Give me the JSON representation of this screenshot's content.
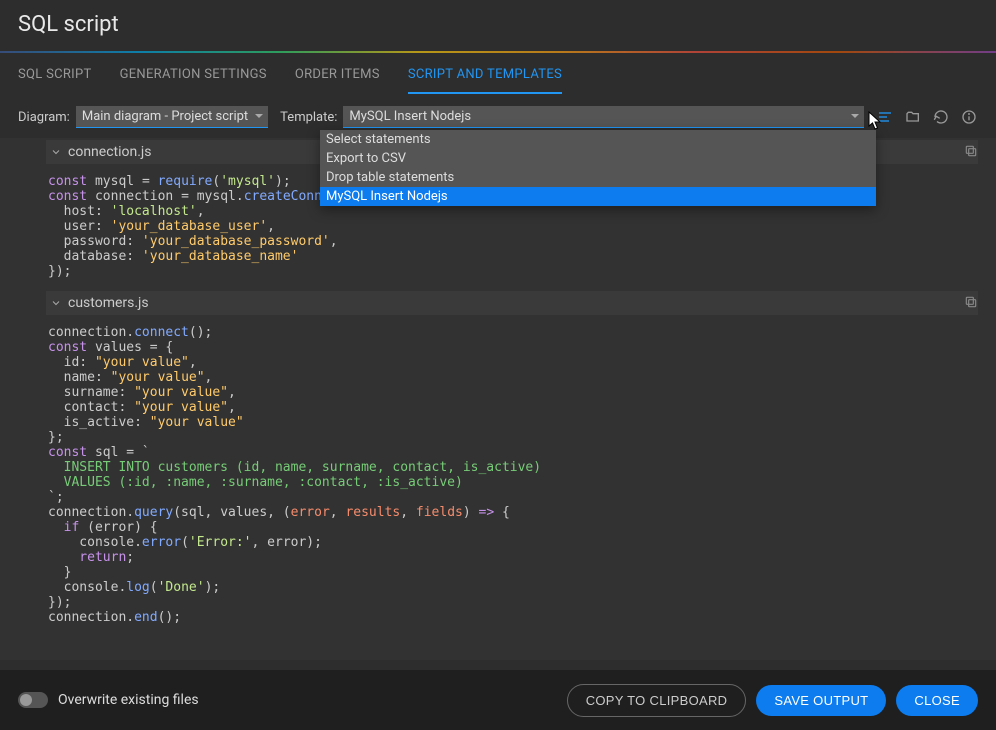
{
  "title": "SQL script",
  "tabs": [
    "SQL SCRIPT",
    "GENERATION SETTINGS",
    "ORDER ITEMS",
    "SCRIPT AND TEMPLATES"
  ],
  "diagram_label": "Diagram:",
  "diagram_value": "Main diagram - Project script",
  "template_label": "Template:",
  "template_value": "MySQL Insert Nodejs",
  "dropdown_options": [
    "Select statements",
    "Export to CSV",
    "Drop table statements",
    "MySQL Insert Nodejs"
  ],
  "files": {
    "file1": {
      "name": "connection.js",
      "code_tokens": [
        {
          "t": "const",
          "c": "kw"
        },
        {
          "t": " mysql ",
          "c": "id"
        },
        {
          "t": "=",
          "c": "id"
        },
        {
          "t": " ",
          "c": "id"
        },
        {
          "t": "require",
          "c": "fn"
        },
        {
          "t": "(",
          "c": "id"
        },
        {
          "t": "'mysql'",
          "c": "str"
        },
        {
          "t": ");\n",
          "c": "id"
        },
        {
          "t": "const",
          "c": "kw"
        },
        {
          "t": " connection ",
          "c": "id"
        },
        {
          "t": "=",
          "c": "id"
        },
        {
          "t": " mysql.",
          "c": "id"
        },
        {
          "t": "createConnection",
          "c": "fn"
        },
        {
          "t": "({\n",
          "c": "id"
        },
        {
          "t": "  host: ",
          "c": "id"
        },
        {
          "t": "'localhost'",
          "c": "str"
        },
        {
          "t": ",\n",
          "c": "id"
        },
        {
          "t": "  user: ",
          "c": "id"
        },
        {
          "t": "'your_database_user'",
          "c": "str2"
        },
        {
          "t": ",\n",
          "c": "id"
        },
        {
          "t": "  password: ",
          "c": "id"
        },
        {
          "t": "'your_database_password'",
          "c": "str2"
        },
        {
          "t": ",\n",
          "c": "id"
        },
        {
          "t": "  database: ",
          "c": "id"
        },
        {
          "t": "'your_database_name'",
          "c": "str2"
        },
        {
          "t": "\n",
          "c": "id"
        },
        {
          "t": "});",
          "c": "id"
        }
      ]
    },
    "file2": {
      "name": "customers.js",
      "code_tokens": [
        {
          "t": "connection.",
          "c": "id"
        },
        {
          "t": "connect",
          "c": "fn"
        },
        {
          "t": "();\n",
          "c": "id"
        },
        {
          "t": "const",
          "c": "kw"
        },
        {
          "t": " values ",
          "c": "id"
        },
        {
          "t": "=",
          "c": "id"
        },
        {
          "t": " {\n",
          "c": "id"
        },
        {
          "t": "  id: ",
          "c": "id"
        },
        {
          "t": "\"your value\"",
          "c": "str2"
        },
        {
          "t": ",\n",
          "c": "id"
        },
        {
          "t": "  name: ",
          "c": "id"
        },
        {
          "t": "\"your value\"",
          "c": "str2"
        },
        {
          "t": ",\n",
          "c": "id"
        },
        {
          "t": "  surname: ",
          "c": "id"
        },
        {
          "t": "\"your value\"",
          "c": "str2"
        },
        {
          "t": ",\n",
          "c": "id"
        },
        {
          "t": "  contact: ",
          "c": "id"
        },
        {
          "t": "\"your value\"",
          "c": "str2"
        },
        {
          "t": ",\n",
          "c": "id"
        },
        {
          "t": "  is_active: ",
          "c": "id"
        },
        {
          "t": "\"your value\"",
          "c": "str2"
        },
        {
          "t": "\n",
          "c": "id"
        },
        {
          "t": "};\n",
          "c": "id"
        },
        {
          "t": "const",
          "c": "kw"
        },
        {
          "t": " sql ",
          "c": "id"
        },
        {
          "t": "=",
          "c": "id"
        },
        {
          "t": " `\n",
          "c": "id"
        },
        {
          "t": "  INSERT INTO customers (id, name, surname, contact, is_active)\n",
          "c": "cm"
        },
        {
          "t": "  VALUES (:id, :name, :surname, :contact, :is_active)\n",
          "c": "cm"
        },
        {
          "t": "`;\n",
          "c": "id"
        },
        {
          "t": "connection.",
          "c": "id"
        },
        {
          "t": "query",
          "c": "fn"
        },
        {
          "t": "(sql, values, (",
          "c": "id"
        },
        {
          "t": "error",
          "c": "param"
        },
        {
          "t": ", ",
          "c": "id"
        },
        {
          "t": "results",
          "c": "param"
        },
        {
          "t": ", ",
          "c": "id"
        },
        {
          "t": "fields",
          "c": "param"
        },
        {
          "t": ") ",
          "c": "id"
        },
        {
          "t": "=>",
          "c": "kw"
        },
        {
          "t": " {\n",
          "c": "id"
        },
        {
          "t": "  if",
          "c": "kw"
        },
        {
          "t": " (error) {\n",
          "c": "id"
        },
        {
          "t": "    console.",
          "c": "id"
        },
        {
          "t": "error",
          "c": "fn"
        },
        {
          "t": "(",
          "c": "id"
        },
        {
          "t": "'Error:'",
          "c": "str"
        },
        {
          "t": ", error);\n",
          "c": "id"
        },
        {
          "t": "    return",
          "c": "kw"
        },
        {
          "t": ";\n",
          "c": "id"
        },
        {
          "t": "  }\n",
          "c": "id"
        },
        {
          "t": "  console.",
          "c": "id"
        },
        {
          "t": "log",
          "c": "fn"
        },
        {
          "t": "(",
          "c": "id"
        },
        {
          "t": "'Done'",
          "c": "str"
        },
        {
          "t": ");\n",
          "c": "id"
        },
        {
          "t": "});\n",
          "c": "id"
        },
        {
          "t": "connection.",
          "c": "id"
        },
        {
          "t": "end",
          "c": "fn"
        },
        {
          "t": "();",
          "c": "id"
        }
      ]
    }
  },
  "footer": {
    "overwrite_label": "Overwrite existing files",
    "copy_btn": "COPY TO CLIPBOARD",
    "save_btn": "SAVE OUTPUT",
    "close_btn": "CLOSE"
  }
}
